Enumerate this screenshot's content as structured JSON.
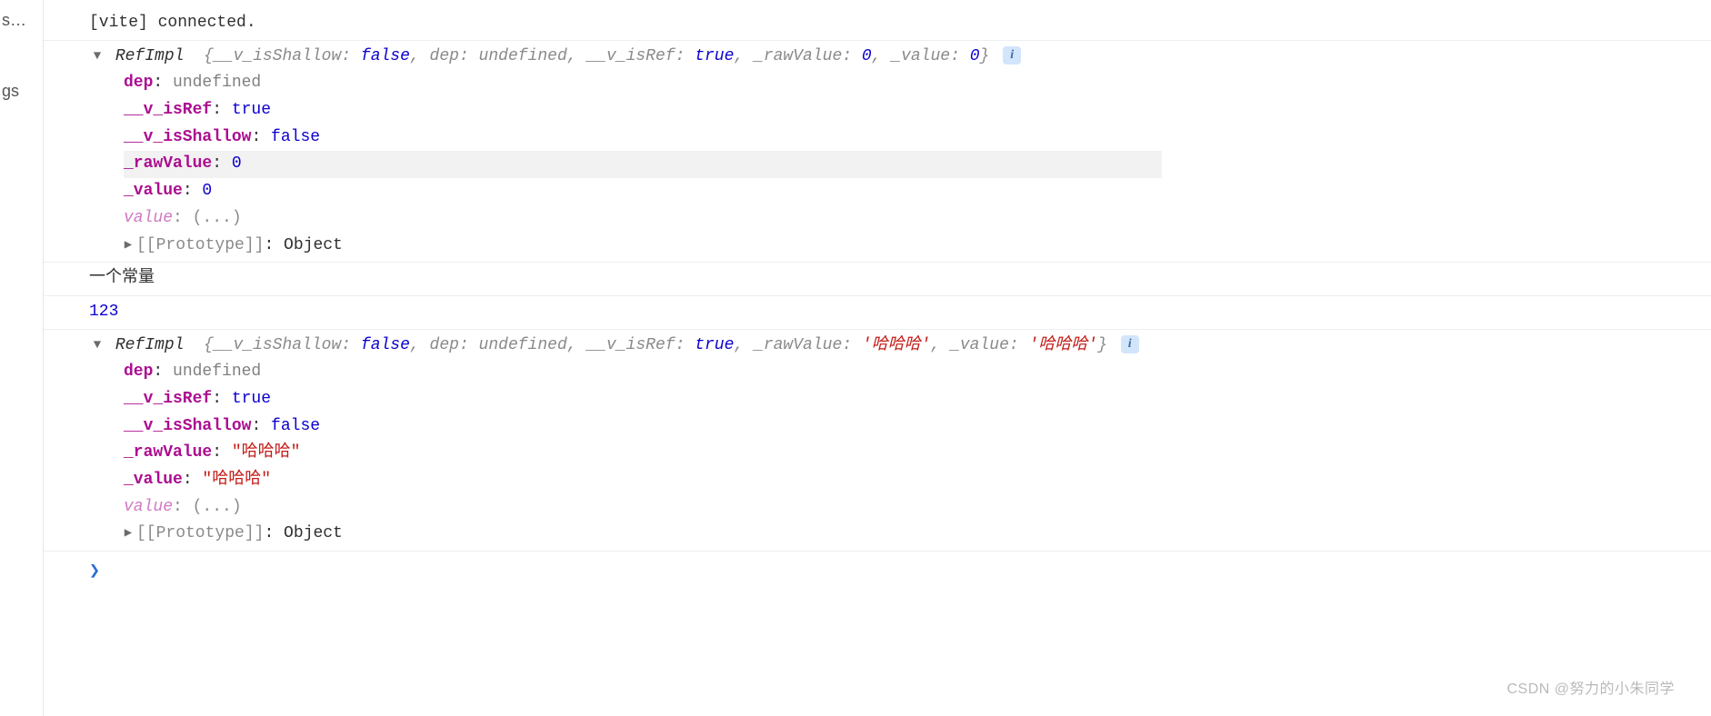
{
  "sidebar": {
    "item0": "s…",
    "item1": "gs"
  },
  "glyphs": {
    "down": "▼",
    "right": "▶",
    "info": "i",
    "prompt": "❯"
  },
  "log0": {
    "text": "[vite] connected."
  },
  "obj1": {
    "class": "RefImpl",
    "preview": {
      "p0k": "__v_isShallow",
      "p0v": "false",
      "p1k": "dep",
      "p1v": "undefined",
      "p2k": "__v_isRef",
      "p2v": "true",
      "p3k": "_rawValue",
      "p3v": "0",
      "p4k": "_value",
      "p4v": "0"
    },
    "props": {
      "depK": "dep",
      "depV": "undefined",
      "isRefK": "__v_isRef",
      "isRefV": "true",
      "isShallowK": "__v_isShallow",
      "isShallowV": "false",
      "rawK": "_rawValue",
      "rawV": "0",
      "valK": "_value",
      "valV": "0",
      "getterK": "value",
      "getterV": "(...)",
      "protoK": "[[Prototype]]",
      "protoV": "Object"
    }
  },
  "log1": {
    "text": "一个常量"
  },
  "log2": {
    "text": "123"
  },
  "obj2": {
    "class": "RefImpl",
    "preview": {
      "p0k": "__v_isShallow",
      "p0v": "false",
      "p1k": "dep",
      "p1v": "undefined",
      "p2k": "__v_isRef",
      "p2v": "true",
      "p3k": "_rawValue",
      "p3v": "'哈哈哈'",
      "p4k": "_value",
      "p4v": "'哈哈哈'"
    },
    "props": {
      "depK": "dep",
      "depV": "undefined",
      "isRefK": "__v_isRef",
      "isRefV": "true",
      "isShallowK": "__v_isShallow",
      "isShallowV": "false",
      "rawK": "_rawValue",
      "rawV": "\"哈哈哈\"",
      "valK": "_value",
      "valV": "\"哈哈哈\"",
      "getterK": "value",
      "getterV": "(...)",
      "protoK": "[[Prototype]]",
      "protoV": "Object"
    }
  },
  "watermark": "CSDN @努力的小朱同学"
}
